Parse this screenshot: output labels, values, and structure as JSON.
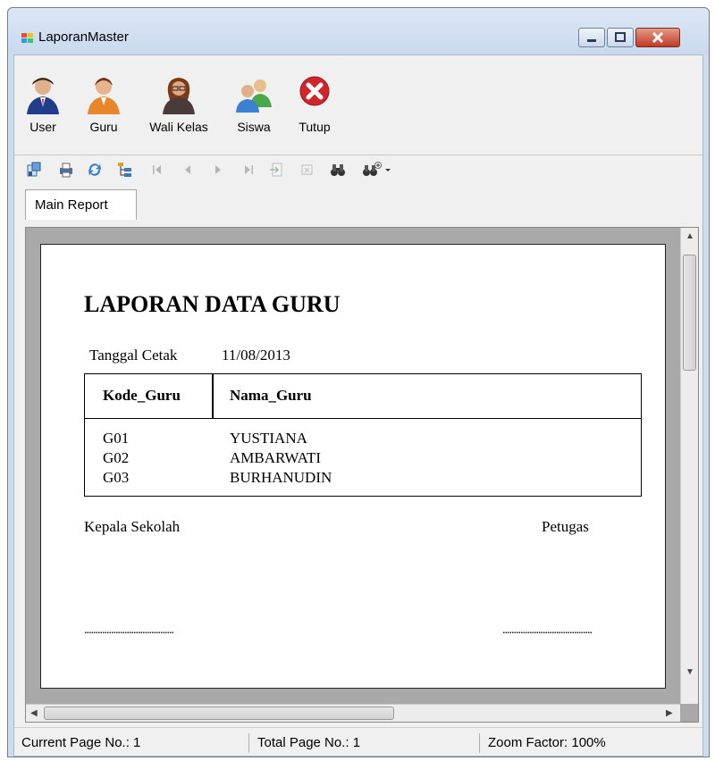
{
  "window": {
    "title": "LaporanMaster",
    "colors": {
      "titlebar": "#c9d9ee",
      "close": "#c13a24"
    }
  },
  "toolbar": {
    "buttons": [
      {
        "label": "User",
        "icon": "user-icon"
      },
      {
        "label": "Guru",
        "icon": "teacher-icon"
      },
      {
        "label": "Wali Kelas",
        "icon": "homeroom-teacher-icon"
      },
      {
        "label": "Siswa",
        "icon": "students-icon"
      },
      {
        "label": "Tutup",
        "icon": "close-icon"
      }
    ]
  },
  "viewer_toolbar": {
    "icons": [
      "export-icon",
      "print-icon",
      "refresh-icon",
      "group-tree-icon",
      "first-page-icon",
      "previous-page-icon",
      "next-page-icon",
      "last-page-icon",
      "goto-page-icon",
      "stop-icon",
      "find-icon",
      "zoom-icon"
    ]
  },
  "tab": {
    "label": "Main Report"
  },
  "report": {
    "title": "LAPORAN DATA GURU",
    "print_date_label": "Tanggal Cetak",
    "print_date_value": "11/08/2013",
    "table": {
      "headers": [
        "Kode_Guru",
        "Nama_Guru"
      ],
      "rows": [
        [
          "G01",
          "YUSTIANA"
        ],
        [
          "G02",
          "AMBARWATI"
        ],
        [
          "G03",
          "BURHANUDIN"
        ]
      ]
    },
    "signature_left": "Kepala Sekolah",
    "signature_right": "Petugas",
    "signature_line": "........................................"
  },
  "statusbar": {
    "current_page": "Current Page No.: 1",
    "total_page": "Total Page No.: 1",
    "zoom": "Zoom Factor: 100%"
  }
}
